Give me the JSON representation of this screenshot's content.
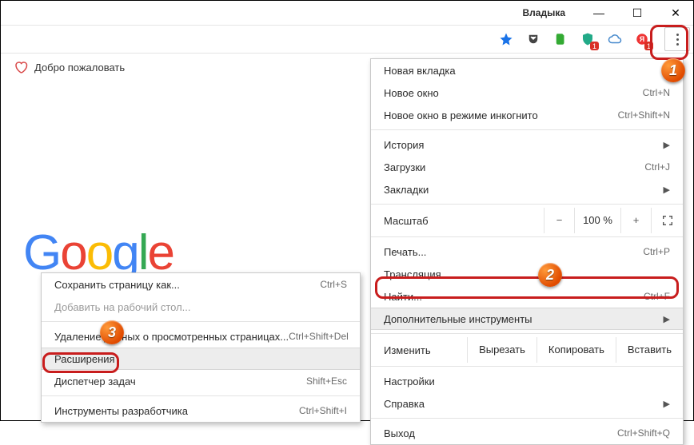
{
  "window": {
    "user": "Владыка"
  },
  "toolbar": {
    "star_icon": "star-icon",
    "ext_icons": [
      "pocket-icon",
      "evernote-icon",
      "shield-icon",
      "opera-icon",
      "cloud-icon",
      "yandex-icon"
    ]
  },
  "welcome": {
    "label": "Добро пожаловать"
  },
  "menu": {
    "new_tab": "Новая вкладка",
    "new_window": "Новое окно",
    "new_window_sc": "Ctrl+N",
    "incognito": "Новое окно в режиме инкогнито",
    "incognito_sc": "Ctrl+Shift+N",
    "history": "История",
    "downloads": "Загрузки",
    "downloads_sc": "Ctrl+J",
    "bookmarks": "Закладки",
    "zoom_label": "Масштаб",
    "zoom_value": "100 %",
    "print": "Печать...",
    "print_sc": "Ctrl+P",
    "cast": "Трансляция...",
    "find": "Найти...",
    "find_sc": "Ctrl+F",
    "more_tools": "Дополнительные инструменты",
    "edit_label": "Изменить",
    "cut": "Вырезать",
    "copy": "Копировать",
    "paste": "Вставить",
    "settings": "Настройки",
    "help": "Справка",
    "exit": "Выход",
    "exit_sc": "Ctrl+Shift+Q"
  },
  "submenu": {
    "save_as": "Сохранить страницу как...",
    "save_as_sc": "Ctrl+S",
    "add_to_desktop": "Добавить на рабочий стол...",
    "clear_data": "Удаление данных о просмотренных страницах...",
    "clear_data_sc": "Ctrl+Shift+Del",
    "extensions": "Расширения",
    "task_manager": "Диспетчер задач",
    "task_manager_sc": "Shift+Esc",
    "dev_tools": "Инструменты разработчика",
    "dev_tools_sc": "Ctrl+Shift+I"
  },
  "callouts": {
    "n1": "1",
    "n2": "2",
    "n3": "3"
  }
}
